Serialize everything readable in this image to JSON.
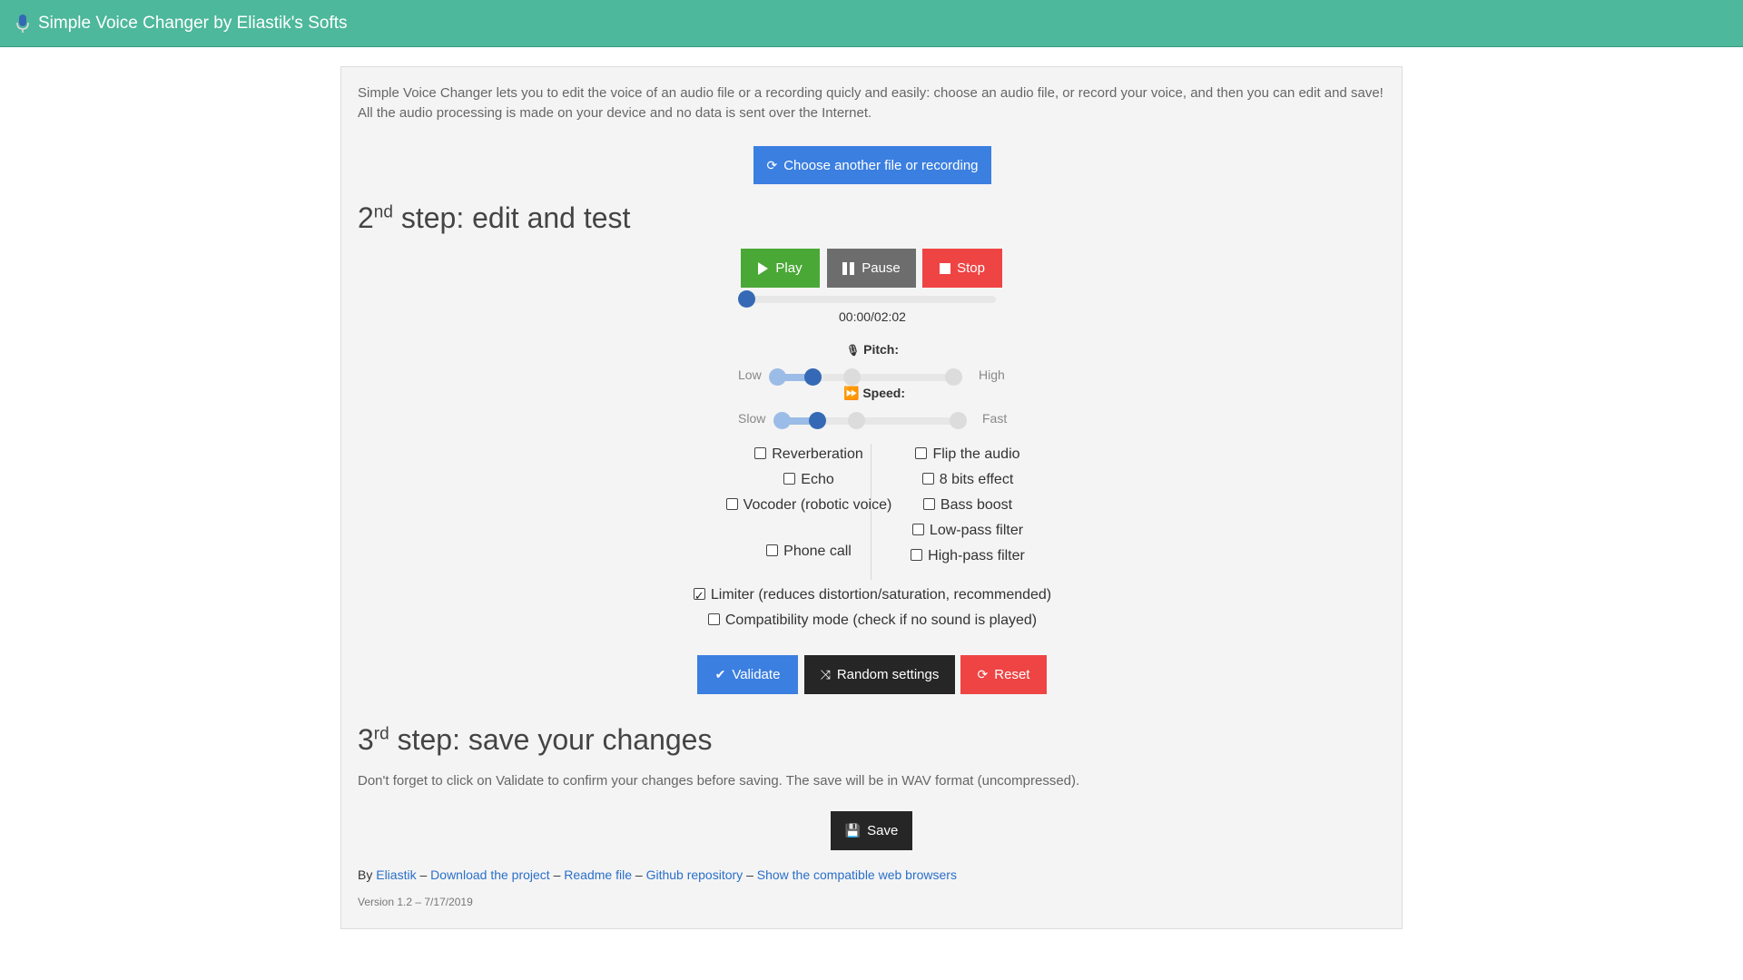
{
  "app": {
    "title": "Simple Voice Changer by Eliastik's Softs"
  },
  "intro": "Simple Voice Changer lets you to edit the voice of an audio file or a recording quicly and easily: choose an audio file, or record your voice, and then you can edit and save! All the audio processing is made on your device and no data is sent over the Internet.",
  "choose_button": "Choose another file or recording",
  "step2": {
    "num": "2",
    "sup": "nd",
    "title": "step: edit and test"
  },
  "player": {
    "play": "Play",
    "pause": "Pause",
    "stop": "Stop",
    "time": "00:00/02:02",
    "progress": 0.0
  },
  "pitch": {
    "label": "Pitch:",
    "low": "Low",
    "high": "High",
    "value": 0.22
  },
  "speed": {
    "label": "Speed:",
    "low": "Slow",
    "high": "Fast",
    "value": 0.22
  },
  "effects_left": [
    {
      "label": "Reverberation",
      "checked": false
    },
    {
      "label": "Echo",
      "checked": false
    },
    {
      "label": "Vocoder (robotic voice)",
      "checked": false
    },
    {
      "label": "Phone call",
      "checked": false
    }
  ],
  "effects_right": [
    {
      "label": "Flip the audio",
      "checked": false
    },
    {
      "label": "8 bits effect",
      "checked": false
    },
    {
      "label": "Bass boost",
      "checked": false
    },
    {
      "label": "Low-pass filter",
      "checked": false
    },
    {
      "label": "High-pass filter",
      "checked": false
    }
  ],
  "limiter": {
    "label": "Limiter (reduces distortion/saturation, recommended)",
    "checked": true
  },
  "compat": {
    "label": "Compatibility mode (check if no sound is played)",
    "checked": false
  },
  "actions": {
    "validate": "Validate",
    "random": "Random settings",
    "reset": "Reset"
  },
  "step3": {
    "num": "3",
    "sup": "rd",
    "title": "step: save your changes"
  },
  "save_note": "Don't forget to click on Validate to confirm your changes before saving. The save will be in WAV format (uncompressed).",
  "save_button": "Save",
  "footer": {
    "by": "By",
    "author": "Eliastik",
    "sep": "–",
    "download": "Download the project",
    "readme": "Readme file",
    "github": "Github repository",
    "browsers": "Show the compatible web browsers",
    "version": "Version 1.2 – 7/17/2019"
  },
  "colors": {
    "topbar": "#4db89b",
    "primary": "#3b7fe0",
    "success": "#4aa836",
    "danger": "#ef4444",
    "dark": "#262626",
    "grey": "#6d6d6d"
  }
}
